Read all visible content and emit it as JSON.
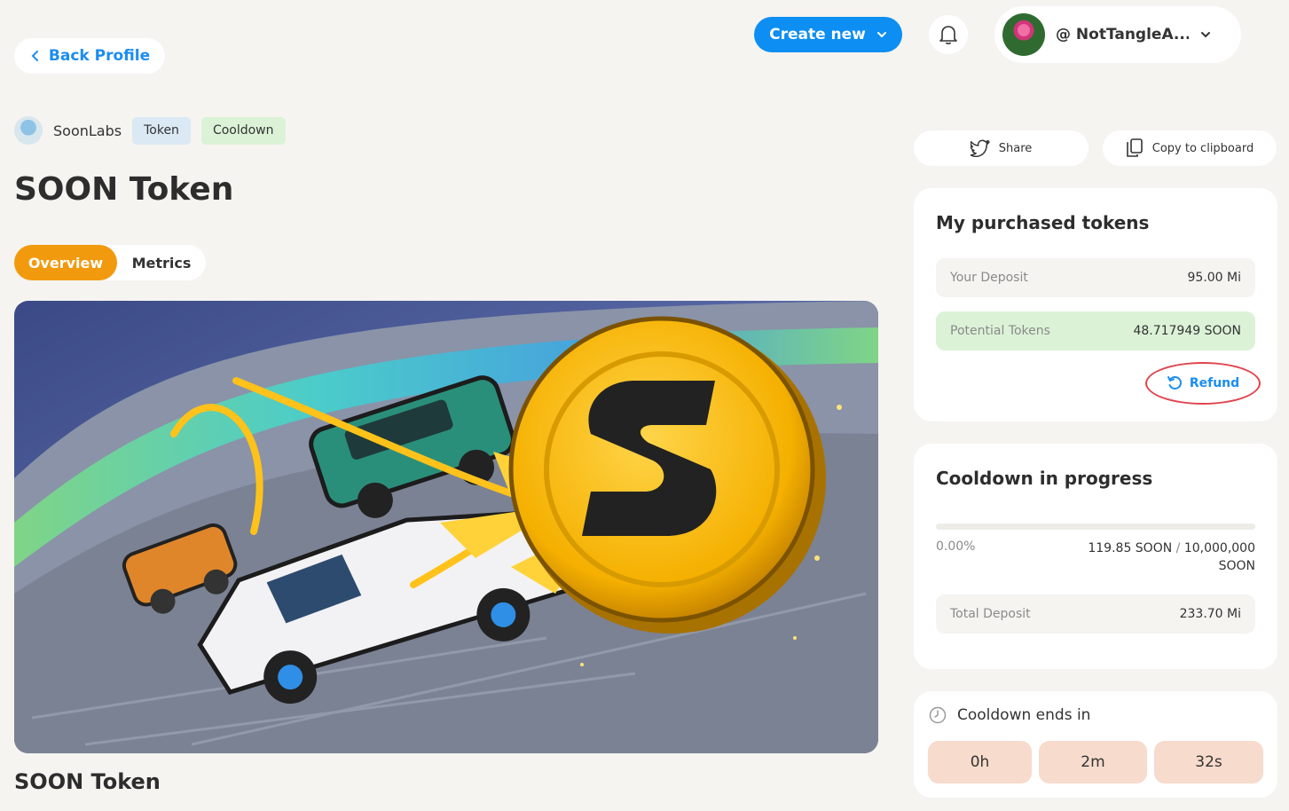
{
  "header": {
    "back_label": "Back Profile",
    "create_label": "Create new",
    "user_name": "@ NotTangleA..."
  },
  "breadcrumb": {
    "space_name": "SoonLabs",
    "tags": [
      "Token",
      "Cooldown"
    ]
  },
  "page": {
    "title": "SOON Token",
    "tabs": [
      "Overview",
      "Metrics"
    ],
    "active_tab": "Overview",
    "section_title": "SOON Token"
  },
  "actions": {
    "share_label": "Share",
    "copy_label": "Copy to clipboard"
  },
  "purchased": {
    "title": "My purchased tokens",
    "deposit_label": "Your Deposit",
    "deposit_value": "95.00 Mi",
    "potential_label": "Potential Tokens",
    "potential_value": "48.717949 SOON",
    "refund_label": "Refund"
  },
  "cooldown": {
    "title": "Cooldown in progress",
    "progress_pct": "0.00%",
    "progress_fraction": 0,
    "sold": "119.85 SOON",
    "separator": "/",
    "total": "10,000,000",
    "unit": "SOON",
    "total_deposit_label": "Total Deposit",
    "total_deposit_value": "233.70 Mi"
  },
  "ends": {
    "label": "Cooldown ends in",
    "hours": "0h",
    "minutes": "2m",
    "seconds": "32s"
  },
  "colors": {
    "primary": "#0d8ef2",
    "accent": "#f29a0d",
    "highlight": "#e0444d"
  }
}
